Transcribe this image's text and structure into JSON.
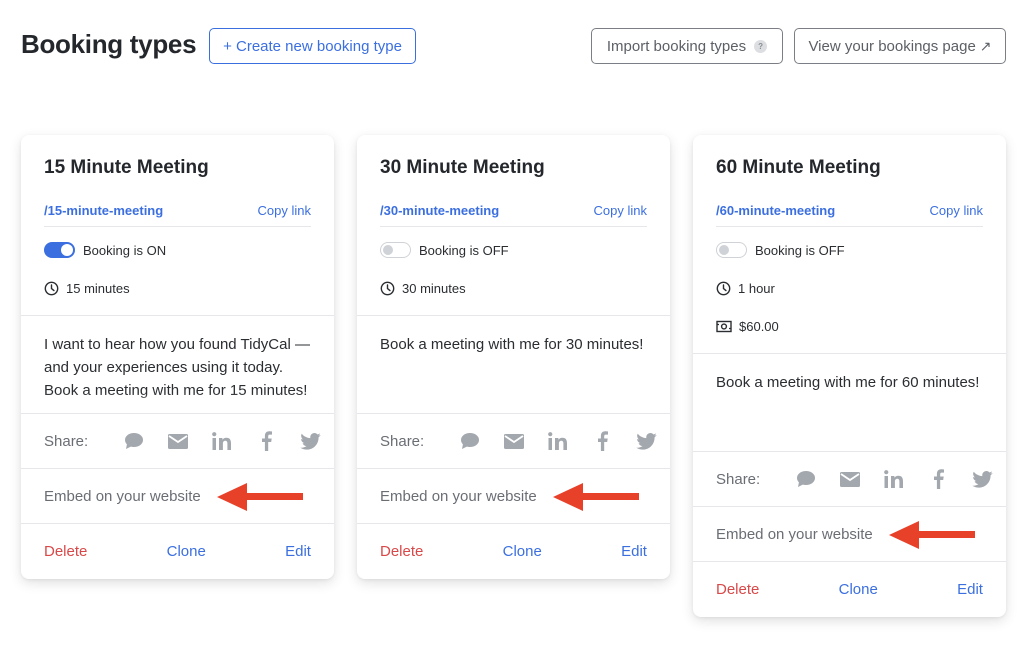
{
  "header": {
    "title": "Booking types",
    "create_button": "+ Create new booking type",
    "import_button": "Import booking types",
    "import_help": "?",
    "view_button": "View your bookings page",
    "view_icon": "↗"
  },
  "colors": {
    "accent": "#3b6fe0",
    "danger": "#d94848",
    "annotation_arrow": "#e8412a"
  },
  "cards": [
    {
      "title": "15 Minute Meeting",
      "slug": "/15-minute-meeting",
      "copy_link": "Copy link",
      "booking_on": true,
      "booking_status": "Booking is ON",
      "duration": "15 minutes",
      "description": "I want to hear how you found TidyCal — and your experiences using it today. Book a meeting with me for 15 minutes!",
      "share_label": "Share:",
      "embed_label": "Embed on your website",
      "delete_label": "Delete",
      "clone_label": "Clone",
      "edit_label": "Edit"
    },
    {
      "title": "30 Minute Meeting",
      "slug": "/30-minute-meeting",
      "copy_link": "Copy link",
      "booking_on": false,
      "booking_status": "Booking is OFF",
      "duration": "30 minutes",
      "description": "Book a meeting with me for 30 minutes!",
      "share_label": "Share:",
      "embed_label": "Embed on your website",
      "delete_label": "Delete",
      "clone_label": "Clone",
      "edit_label": "Edit"
    },
    {
      "title": "60 Minute Meeting",
      "slug": "/60-minute-meeting",
      "copy_link": "Copy link",
      "booking_on": false,
      "booking_status": "Booking is OFF",
      "duration": "1 hour",
      "price": "$60.00",
      "description": "Book a meeting with me for 60 minutes!",
      "share_label": "Share:",
      "embed_label": "Embed on your website",
      "delete_label": "Delete",
      "clone_label": "Clone",
      "edit_label": "Edit"
    }
  ],
  "share_icons": [
    "sms-icon",
    "email-icon",
    "linkedin-icon",
    "facebook-icon",
    "twitter-icon"
  ]
}
